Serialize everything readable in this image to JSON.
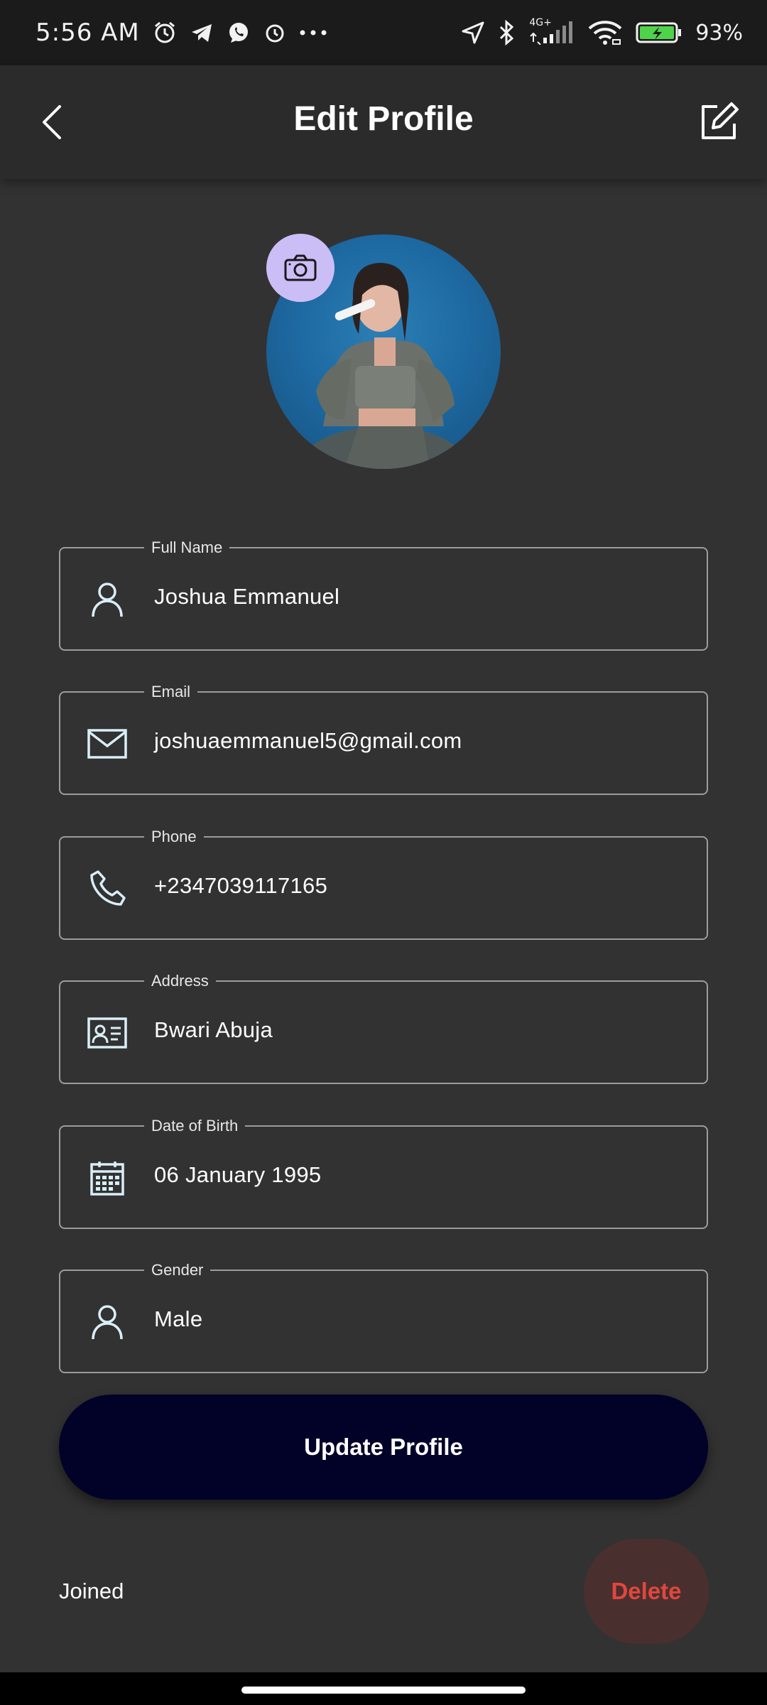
{
  "status_bar": {
    "time": "5:56 AM",
    "network": "4G+",
    "battery": "93%",
    "left_icons": [
      "alarm-icon",
      "telegram-icon",
      "whatsapp-icon",
      "clock-icon",
      "more-dots-icon"
    ],
    "right_icons": [
      "location-arrow-icon",
      "bluetooth-icon",
      "signal-icon",
      "wifi-icon",
      "battery-icon"
    ]
  },
  "header": {
    "title": "Edit Profile",
    "back_icon": "chevron-left-icon",
    "edit_icon": "edit-square-icon"
  },
  "avatar": {
    "camera_icon": "camera-icon",
    "camera_bg": "#cbbef7"
  },
  "fields": [
    {
      "label": "Full Name",
      "value": "Joshua Emmanuel",
      "icon": "person-icon"
    },
    {
      "label": "Email",
      "value": "joshuaemmanuel5@gmail.com",
      "icon": "mail-icon"
    },
    {
      "label": "Phone",
      "value": "+2347039117165",
      "icon": "phone-icon"
    },
    {
      "label": "Address",
      "value": "Bwari Abuja",
      "icon": "id-card-icon"
    },
    {
      "label": "Date of Birth",
      "value": "06 January 1995",
      "icon": "calendar-icon"
    },
    {
      "label": "Gender",
      "value": "Male",
      "icon": "person-icon"
    }
  ],
  "actions": {
    "update_label": "Update Profile",
    "joined_label": "Joined",
    "delete_label": "Delete"
  },
  "colors": {
    "background": "#323232",
    "appbar": "#2b2b2b",
    "update_button": "#020128",
    "delete_text": "#e0473d",
    "delete_bg": "#4a2f2f",
    "field_border": "#9c9c9c",
    "icon_tint": "#d9eef8"
  }
}
